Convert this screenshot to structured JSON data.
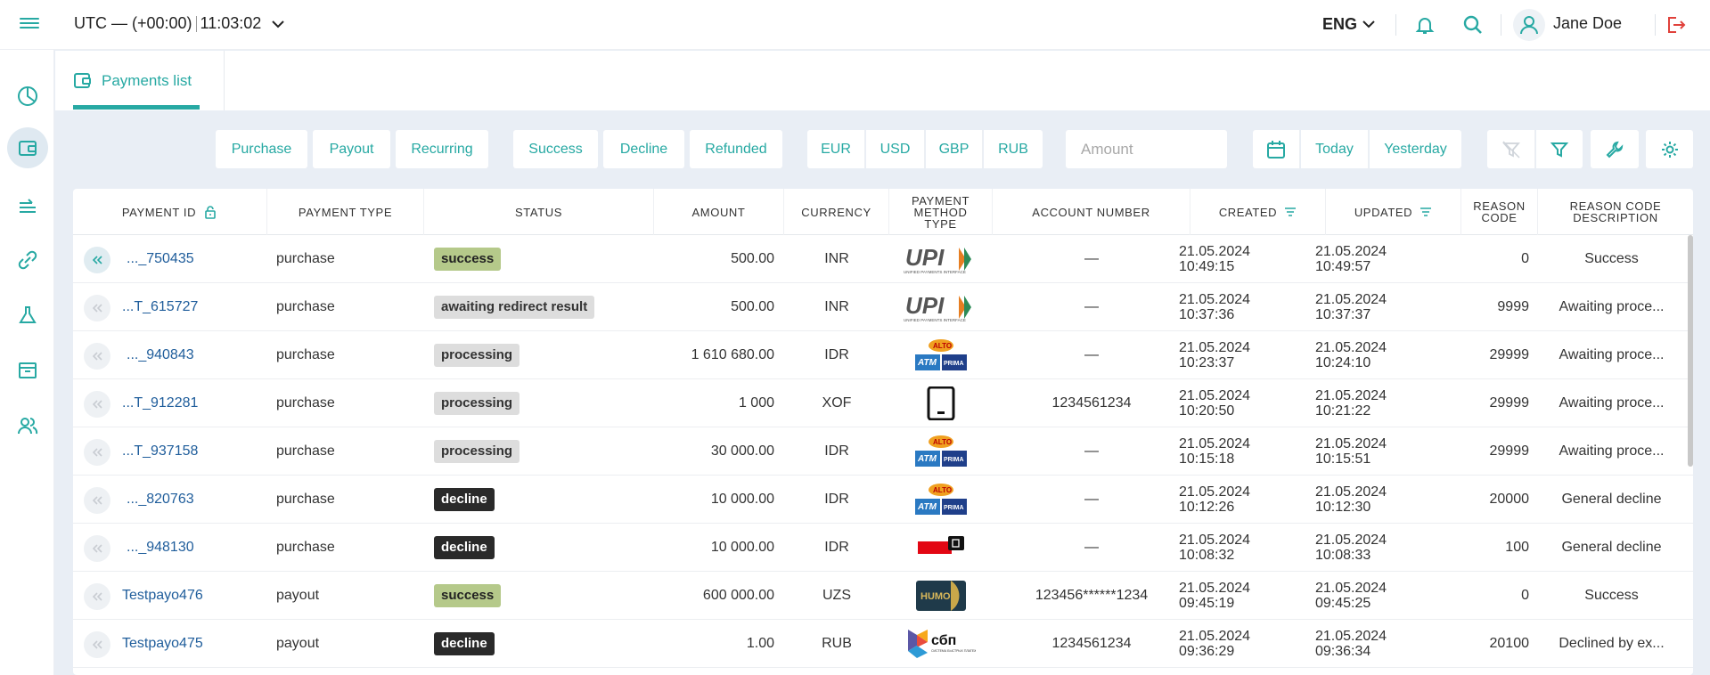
{
  "header": {
    "timezone": "UTC — (+00:00)",
    "time": "11:03:02",
    "language": "ENG",
    "user_name": "Jane Doe"
  },
  "sidebar": {
    "items": [
      {
        "icon": "dashboard-icon"
      },
      {
        "icon": "wallet-icon",
        "active": true
      },
      {
        "icon": "transfers-icon"
      },
      {
        "icon": "link-icon"
      },
      {
        "icon": "flask-icon"
      },
      {
        "icon": "archive-icon"
      },
      {
        "icon": "users-icon"
      }
    ]
  },
  "tabs": [
    {
      "label": "Payments list"
    }
  ],
  "filters": {
    "type": [
      "Purchase",
      "Payout",
      "Recurring"
    ],
    "status": [
      "Success",
      "Decline",
      "Refunded"
    ],
    "currency": [
      "EUR",
      "USD",
      "GBP",
      "RUB"
    ],
    "amount_placeholder": "Amount",
    "date": [
      "Today",
      "Yesterday"
    ]
  },
  "table": {
    "columns": [
      "PAYMENT ID",
      "PAYMENT TYPE",
      "STATUS",
      "AMOUNT",
      "CURRENCY",
      "PAYMENT METHOD TYPE",
      "ACCOUNT NUMBER",
      "CREATED",
      "UPDATED",
      "REASON CODE",
      "REASON CODE DESCRIPTION"
    ],
    "rows": [
      {
        "id": "..._750435",
        "type": "purchase",
        "status": "success",
        "amount": "500.00",
        "currency": "INR",
        "method": "upi",
        "account": "—",
        "created": [
          "21.05.2024",
          "10:49:15"
        ],
        "updated": [
          "21.05.2024",
          "10:49:57"
        ],
        "code": "0",
        "desc": "Success"
      },
      {
        "id": "...T_615727",
        "type": "purchase",
        "status": "awaiting redirect result",
        "amount": "500.00",
        "currency": "INR",
        "method": "upi",
        "account": "—",
        "created": [
          "21.05.2024",
          "10:37:36"
        ],
        "updated": [
          "21.05.2024",
          "10:37:37"
        ],
        "code": "9999",
        "desc": "Awaiting proce..."
      },
      {
        "id": "..._940843",
        "type": "purchase",
        "status": "processing",
        "amount": "1 610 680.00",
        "currency": "IDR",
        "method": "atm",
        "account": "—",
        "created": [
          "21.05.2024",
          "10:23:37"
        ],
        "updated": [
          "21.05.2024",
          "10:24:10"
        ],
        "code": "29999",
        "desc": "Awaiting proce..."
      },
      {
        "id": "...T_912281",
        "type": "purchase",
        "status": "processing",
        "amount": "1 000",
        "currency": "XOF",
        "method": "mobile",
        "account": "1234561234",
        "created": [
          "21.05.2024",
          "10:20:50"
        ],
        "updated": [
          "21.05.2024",
          "10:21:22"
        ],
        "code": "29999",
        "desc": "Awaiting proce..."
      },
      {
        "id": "...T_937158",
        "type": "purchase",
        "status": "processing",
        "amount": "30 000.00",
        "currency": "IDR",
        "method": "atm",
        "account": "—",
        "created": [
          "21.05.2024",
          "10:15:18"
        ],
        "updated": [
          "21.05.2024",
          "10:15:51"
        ],
        "code": "29999",
        "desc": "Awaiting proce..."
      },
      {
        "id": "..._820763",
        "type": "purchase",
        "status": "decline",
        "amount": "10 000.00",
        "currency": "IDR",
        "method": "atm",
        "account": "—",
        "created": [
          "21.05.2024",
          "10:12:26"
        ],
        "updated": [
          "21.05.2024",
          "10:12:30"
        ],
        "code": "20000",
        "desc": "General decline"
      },
      {
        "id": "..._948130",
        "type": "purchase",
        "status": "decline",
        "amount": "10 000.00",
        "currency": "IDR",
        "method": "card",
        "account": "—",
        "created": [
          "21.05.2024",
          "10:08:32"
        ],
        "updated": [
          "21.05.2024",
          "10:08:33"
        ],
        "code": "100",
        "desc": "General decline"
      },
      {
        "id": "Testpayo476",
        "type": "payout",
        "status": "success",
        "amount": "600 000.00",
        "currency": "UZS",
        "method": "humo",
        "account": "123456******1234",
        "created": [
          "21.05.2024",
          "09:45:19"
        ],
        "updated": [
          "21.05.2024",
          "09:45:25"
        ],
        "code": "0",
        "desc": "Success"
      },
      {
        "id": "Testpayo475",
        "type": "payout",
        "status": "decline",
        "amount": "1.00",
        "currency": "RUB",
        "method": "sbp",
        "account": "1234561234",
        "created": [
          "21.05.2024",
          "09:36:29"
        ],
        "updated": [
          "21.05.2024",
          "09:36:34"
        ],
        "code": "20100",
        "desc": "Declined by ex..."
      }
    ]
  },
  "logos": {
    "upi_text": "UPI",
    "upi_sub": "UNIFIED PAYMENTS INTERFACE",
    "atm_top": "ALTO",
    "atm_left": "ATM",
    "atm_right": "PRIMA",
    "humo": "HUMO",
    "sbp": "сбп",
    "sbp_sub": "СИСТЕМА БЫСТРЫХ ПЛАТЕЖЕЙ"
  },
  "colors": {
    "accent": "#27a9a3",
    "link": "#1f5d9b",
    "success": "#b5c98a",
    "processing": "#dddddd",
    "decline": "#2a2a2a",
    "logout": "#e0413b"
  }
}
